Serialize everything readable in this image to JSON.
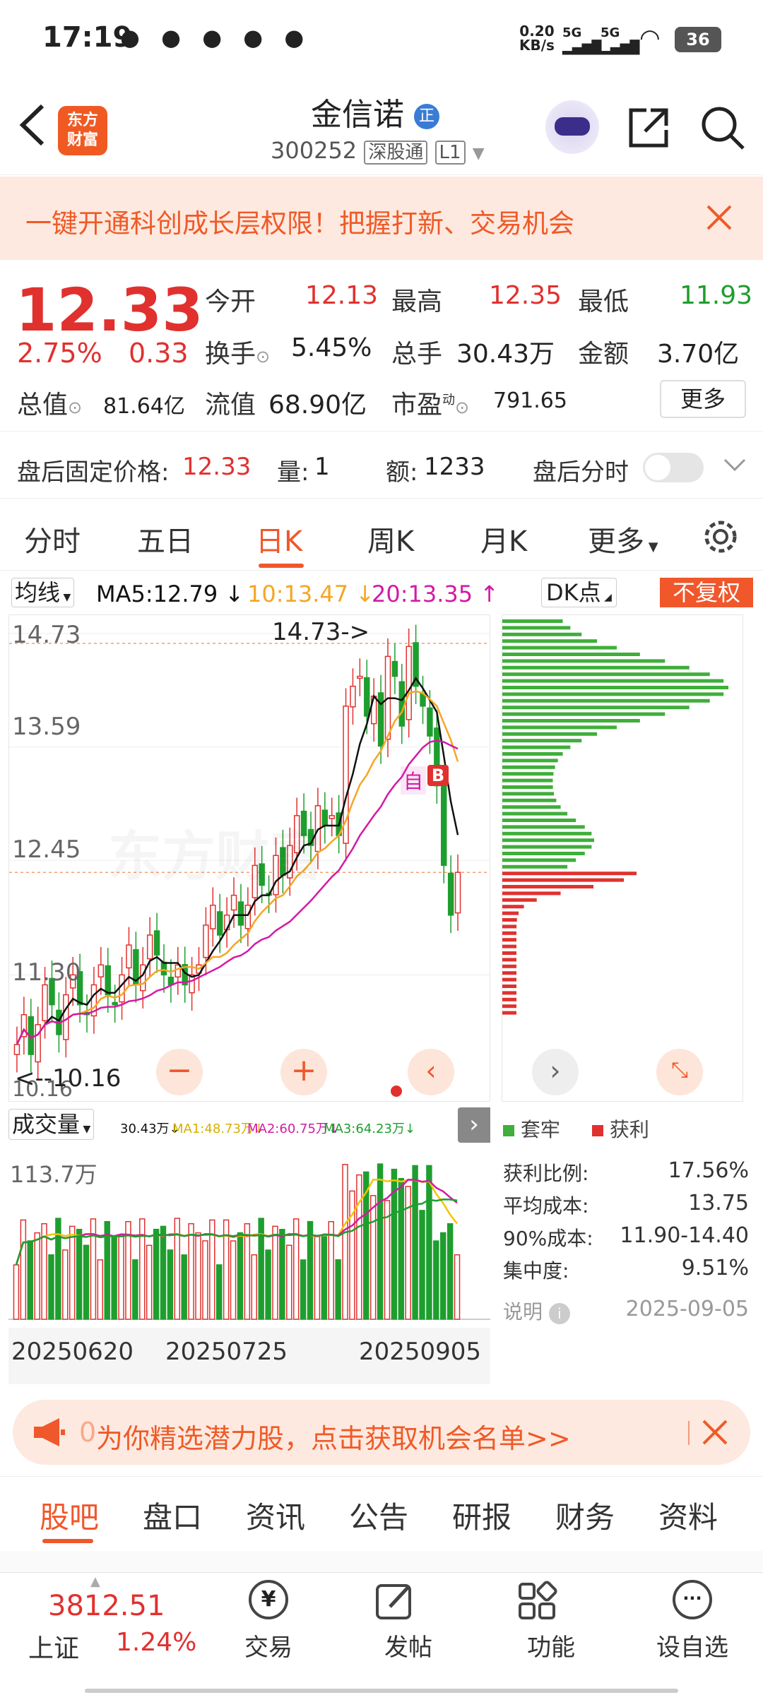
{
  "status_bar": {
    "time": "17:19",
    "net_speed_top": "0.20",
    "net_speed_unit": "KB/s",
    "signal1": "5G",
    "signal2": "5G",
    "battery": "36"
  },
  "header": {
    "logo_line1": "东方",
    "logo_line2": "财富",
    "stock_name": "金信诺",
    "badge": "正",
    "code": "300252",
    "market_tag": "深股通",
    "level_tag": "L1"
  },
  "banner": {
    "text": "一键开通科创成长层权限！把握打新、交易机会"
  },
  "quote": {
    "price": "12.33",
    "change_pct": "2.75%",
    "change_abs": "0.33",
    "open_label": "今开",
    "open_value": "12.13",
    "high_label": "最高",
    "high_value": "12.35",
    "low_label": "最低",
    "low_value": "11.93",
    "turnover_label": "换手",
    "turnover_value": "5.45%",
    "volume_label": "总手",
    "volume_value": "30.43万",
    "amount_label": "金额",
    "amount_value": "3.70亿",
    "mktcap_label": "总值",
    "mktcap_value": "81.64亿",
    "float_label": "流值",
    "float_value": "68.90亿",
    "pe_label": "市盈",
    "pe_sup": "动",
    "pe_value": "791.65",
    "more_button": "更多"
  },
  "after_hours": {
    "price_label": "盘后固定价格:",
    "price_value": "12.33",
    "vol_label": "量:",
    "vol_value": "1",
    "amt_label": "额:",
    "amt_value": "1233",
    "toggle_label": "盘后分时"
  },
  "chart_tabs": [
    {
      "label": "分时",
      "active": false
    },
    {
      "label": "五日",
      "active": false
    },
    {
      "label": "日K",
      "active": true
    },
    {
      "label": "周K",
      "active": false
    },
    {
      "label": "月K",
      "active": false
    },
    {
      "label": "更多",
      "active": false
    }
  ],
  "kline_panel": {
    "ma_selector": "均线",
    "ma5": "MA5:12.79 ↓",
    "ma10": "10:13.47 ↓",
    "ma20": "20:13.35 ↑",
    "dk_button": "DK点",
    "adjust_button": "不复权",
    "y_labels": [
      "14.73",
      "13.59",
      "12.45",
      "11.30",
      "10.16"
    ],
    "max_marker": "14.73->",
    "min_marker": "<--10.16",
    "self_tag": "自",
    "buy_tag": "B",
    "watermark": "东方财富"
  },
  "volume_panel": {
    "selector": "成交量",
    "vol": "30.43万↓",
    "ma1": "MA1:48.73万↓",
    "ma2": "MA2:60.75万↓",
    "ma3": "MA3:64.23万↓",
    "max_label": "113.7万",
    "dates": [
      "20250620",
      "20250725",
      "20250905"
    ]
  },
  "chip_panel": {
    "legend_trapped": "套牢",
    "legend_profit": "获利",
    "rows": [
      {
        "label": "获利比例:",
        "value": "17.56%"
      },
      {
        "label": "平均成本:",
        "value": "13.75"
      },
      {
        "label": "90%成本:",
        "value": "11.90-14.40"
      },
      {
        "label": "集中度:",
        "value": "9.51%"
      }
    ],
    "explain": "说明",
    "date": "2025-09-05"
  },
  "promo": {
    "prefix": "0",
    "text": "为你精选潜力股，点击获取机会名单>>"
  },
  "bottom_tabs": [
    {
      "label": "股吧",
      "active": true
    },
    {
      "label": "盘口",
      "active": false
    },
    {
      "label": "资讯",
      "active": false
    },
    {
      "label": "公告",
      "active": false
    },
    {
      "label": "研报",
      "active": false
    },
    {
      "label": "财务",
      "active": false
    },
    {
      "label": "资料",
      "active": false
    }
  ],
  "bottom_bar": {
    "index_value": "3812.51",
    "index_name": "上证",
    "index_change": "1.24%",
    "trade": "交易",
    "post": "发帖",
    "func": "功能",
    "watchlist": "设自选"
  },
  "colors": {
    "up": "#e0312f",
    "down": "#1e9e2e",
    "accent": "#f0572b",
    "ma5": "#111111",
    "ma10": "#f5a623",
    "ma20": "#d21aa5"
  },
  "chart_data": [
    {
      "type": "candlestick",
      "title": "",
      "y_ticks": [
        14.73,
        13.59,
        12.45,
        11.3,
        10.16
      ],
      "ylim": [
        10.16,
        14.73
      ],
      "x_labels": [
        "20250620",
        "20250725",
        "20250905"
      ],
      "max_price": 14.73,
      "min_price": 10.16,
      "last_close": 12.33,
      "ma_last": {
        "MA5": 12.79,
        "MA10": 13.47,
        "MA20": 13.35
      }
    },
    {
      "type": "bar",
      "title": "成交量",
      "ymax_label": "113.7万",
      "last_volume": "30.43万",
      "ma_last": {
        "MA1": "48.73万",
        "MA2": "60.75万",
        "MA3": "64.23万"
      }
    },
    {
      "type": "bar",
      "title": "",
      "series": [
        {
          "name": "套牢"
        },
        {
          "name": "获利"
        }
      ],
      "profit_ratio": "17.56%",
      "avg_cost": 13.75,
      "cost_90": "11.90-14.40",
      "concentration": "9.51%"
    }
  ]
}
